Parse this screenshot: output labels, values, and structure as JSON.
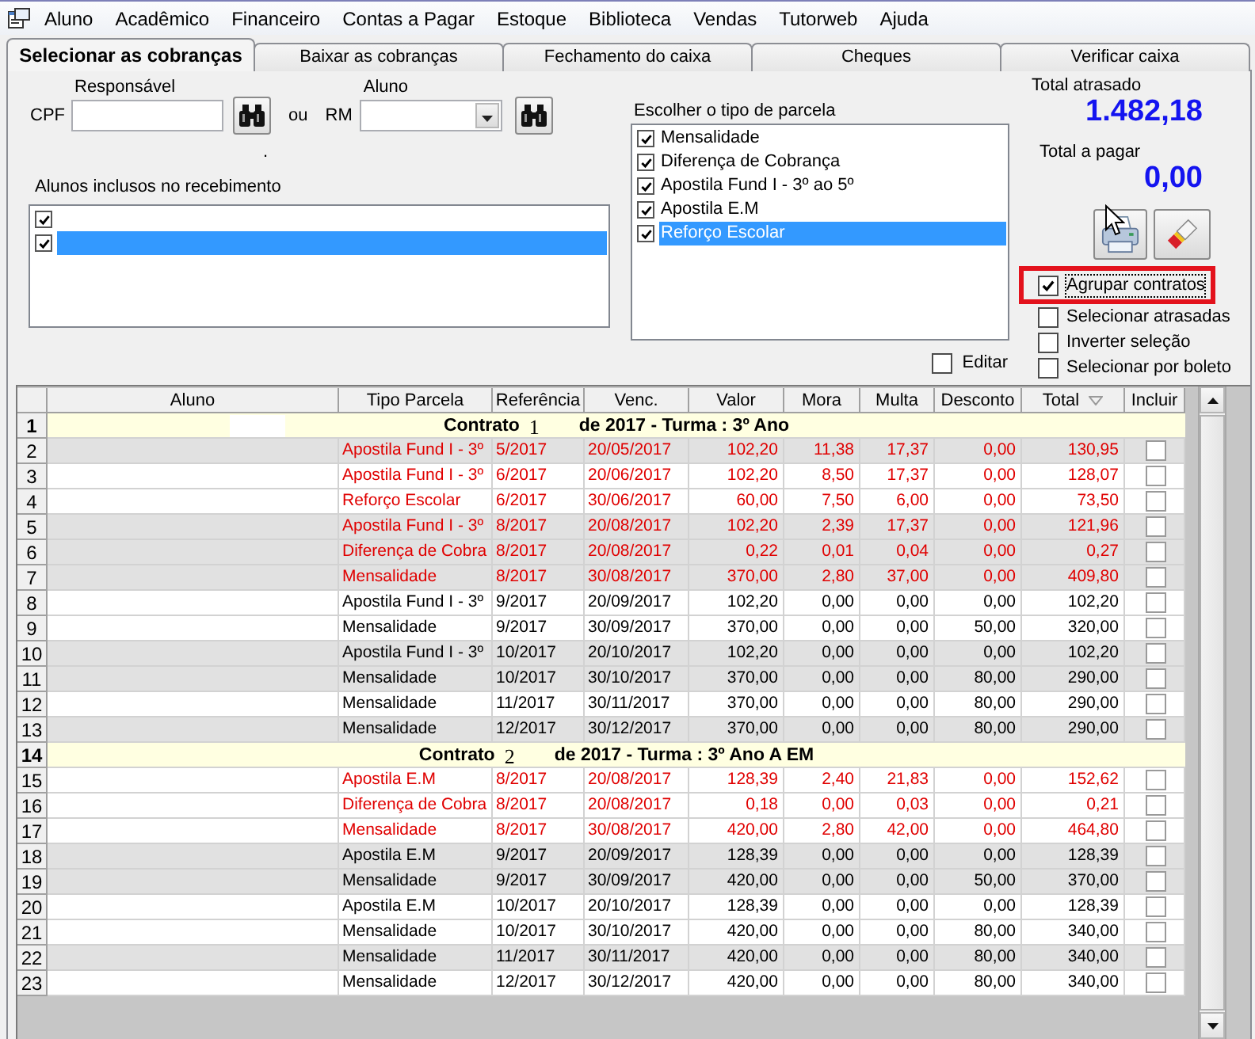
{
  "menu": [
    "Aluno",
    "Acadêmico",
    "Financeiro",
    "Contas a Pagar",
    "Estoque",
    "Biblioteca",
    "Vendas",
    "Tutorweb",
    "Ajuda"
  ],
  "tabs": [
    {
      "label": "Selecionar as cobranças",
      "selected": true
    },
    {
      "label": "Baixar as cobranças",
      "selected": false
    },
    {
      "label": "Fechamento do caixa",
      "selected": false
    },
    {
      "label": "Cheques",
      "selected": false
    },
    {
      "label": "Verificar caixa",
      "selected": false
    }
  ],
  "search": {
    "cpf_label": "CPF",
    "responsible_label": "Responsável",
    "or_label": "ou",
    "rm_label": "RM",
    "student_label": "Aluno"
  },
  "dot_label": ".",
  "included_students": {
    "label": "Alunos inclusos no recebimento",
    "items": [
      {
        "checked": true,
        "selected": false
      },
      {
        "checked": true,
        "selected": true
      }
    ]
  },
  "parcel_types": {
    "label": "Escolher o tipo de parcela",
    "items": [
      {
        "label": "Mensalidade",
        "checked": true,
        "selected": false
      },
      {
        "label": "Diferença de Cobrança",
        "checked": true,
        "selected": false
      },
      {
        "label": "Apostila Fund I - 3º ao 5º",
        "checked": true,
        "selected": false
      },
      {
        "label": "Apostila E.M",
        "checked": true,
        "selected": false
      },
      {
        "label": "Reforço Escolar",
        "checked": true,
        "selected": true
      }
    ]
  },
  "edit_option": {
    "label": "Editar",
    "checked": false
  },
  "totals": [
    {
      "label": "Total atrasado",
      "value": "1.482,18"
    },
    {
      "label": "Total a pagar",
      "value": "0,00"
    }
  ],
  "options": [
    {
      "label": "Agrupar contratos",
      "checked": true,
      "highlighted": true,
      "focused": true
    },
    {
      "label": "Selecionar atrasadas",
      "checked": false,
      "highlighted": false,
      "focused": false
    },
    {
      "label": "Inverter seleção",
      "checked": false,
      "highlighted": false,
      "focused": false
    },
    {
      "label": "Selecionar por boleto",
      "checked": false,
      "highlighted": false,
      "focused": false
    }
  ],
  "grid": {
    "columns": [
      {
        "label": "Aluno",
        "sorted": false
      },
      {
        "label": "Tipo Parcela",
        "sorted": false
      },
      {
        "label": "Referência",
        "sorted": false
      },
      {
        "label": "Venc.",
        "sorted": false
      },
      {
        "label": "Valor",
        "sorted": false
      },
      {
        "label": "Mora",
        "sorted": false
      },
      {
        "label": "Multa",
        "sorted": false
      },
      {
        "label": "Desconto",
        "sorted": false
      },
      {
        "label": "Total",
        "sorted": true
      },
      {
        "label": "Incluir",
        "sorted": false
      }
    ],
    "rows": [
      {
        "kind": "contract",
        "number": "1",
        "title": "Contrato",
        "contract_no": "1",
        "detail": "de 2017 - Turma : 3º Ano",
        "blank_patch": true
      },
      {
        "kind": "item",
        "number": "2",
        "cells": [
          "Apostila Fund I - 3º",
          "5/2017",
          "20/05/2017",
          "102,20",
          "11,38",
          "17,37",
          "0,00",
          "130,95"
        ],
        "overdue": true,
        "shaded": true,
        "included": false
      },
      {
        "kind": "item",
        "number": "3",
        "cells": [
          "Apostila Fund I - 3º",
          "6/2017",
          "20/06/2017",
          "102,20",
          "8,50",
          "17,37",
          "0,00",
          "128,07"
        ],
        "overdue": true,
        "shaded": false,
        "included": false
      },
      {
        "kind": "item",
        "number": "4",
        "cells": [
          "Reforço Escolar",
          "6/2017",
          "30/06/2017",
          "60,00",
          "7,50",
          "6,00",
          "0,00",
          "73,50"
        ],
        "overdue": true,
        "shaded": false,
        "included": false
      },
      {
        "kind": "item",
        "number": "5",
        "cells": [
          "Apostila Fund I - 3º",
          "8/2017",
          "20/08/2017",
          "102,20",
          "2,39",
          "17,37",
          "0,00",
          "121,96"
        ],
        "overdue": true,
        "shaded": true,
        "included": false
      },
      {
        "kind": "item",
        "number": "6",
        "cells": [
          "Diferença de Cobra",
          "8/2017",
          "20/08/2017",
          "0,22",
          "0,01",
          "0,04",
          "0,00",
          "0,27"
        ],
        "overdue": true,
        "shaded": true,
        "included": false
      },
      {
        "kind": "item",
        "number": "7",
        "cells": [
          "Mensalidade",
          "8/2017",
          "30/08/2017",
          "370,00",
          "2,80",
          "37,00",
          "0,00",
          "409,80"
        ],
        "overdue": true,
        "shaded": true,
        "included": false
      },
      {
        "kind": "item",
        "number": "8",
        "cells": [
          "Apostila Fund I - 3º",
          "9/2017",
          "20/09/2017",
          "102,20",
          "0,00",
          "0,00",
          "0,00",
          "102,20"
        ],
        "overdue": false,
        "shaded": false,
        "included": false
      },
      {
        "kind": "item",
        "number": "9",
        "cells": [
          "Mensalidade",
          "9/2017",
          "30/09/2017",
          "370,00",
          "0,00",
          "0,00",
          "50,00",
          "320,00"
        ],
        "overdue": false,
        "shaded": false,
        "included": false
      },
      {
        "kind": "item",
        "number": "10",
        "cells": [
          "Apostila Fund I - 3º",
          "10/2017",
          "20/10/2017",
          "102,20",
          "0,00",
          "0,00",
          "0,00",
          "102,20"
        ],
        "overdue": false,
        "shaded": true,
        "included": false
      },
      {
        "kind": "item",
        "number": "11",
        "cells": [
          "Mensalidade",
          "10/2017",
          "30/10/2017",
          "370,00",
          "0,00",
          "0,00",
          "80,00",
          "290,00"
        ],
        "overdue": false,
        "shaded": true,
        "included": false
      },
      {
        "kind": "item",
        "number": "12",
        "cells": [
          "Mensalidade",
          "11/2017",
          "30/11/2017",
          "370,00",
          "0,00",
          "0,00",
          "80,00",
          "290,00"
        ],
        "overdue": false,
        "shaded": false,
        "included": false
      },
      {
        "kind": "item",
        "number": "13",
        "cells": [
          "Mensalidade",
          "12/2017",
          "30/12/2017",
          "370,00",
          "0,00",
          "0,00",
          "80,00",
          "290,00"
        ],
        "overdue": false,
        "shaded": true,
        "included": false
      },
      {
        "kind": "contract",
        "number": "14",
        "title": "Contrato",
        "contract_no": "2",
        "detail": "de 2017 - Turma : 3º Ano A EM",
        "blank_patch": false
      },
      {
        "kind": "item",
        "number": "15",
        "cells": [
          "Apostila E.M",
          "8/2017",
          "20/08/2017",
          "128,39",
          "2,40",
          "21,83",
          "0,00",
          "152,62"
        ],
        "overdue": true,
        "shaded": false,
        "included": false
      },
      {
        "kind": "item",
        "number": "16",
        "cells": [
          "Diferença de Cobra",
          "8/2017",
          "20/08/2017",
          "0,18",
          "0,00",
          "0,03",
          "0,00",
          "0,21"
        ],
        "overdue": true,
        "shaded": false,
        "included": false
      },
      {
        "kind": "item",
        "number": "17",
        "cells": [
          "Mensalidade",
          "8/2017",
          "30/08/2017",
          "420,00",
          "2,80",
          "42,00",
          "0,00",
          "464,80"
        ],
        "overdue": true,
        "shaded": false,
        "included": false
      },
      {
        "kind": "item",
        "number": "18",
        "cells": [
          "Apostila E.M",
          "9/2017",
          "20/09/2017",
          "128,39",
          "0,00",
          "0,00",
          "0,00",
          "128,39"
        ],
        "overdue": false,
        "shaded": true,
        "included": false
      },
      {
        "kind": "item",
        "number": "19",
        "cells": [
          "Mensalidade",
          "9/2017",
          "30/09/2017",
          "420,00",
          "0,00",
          "0,00",
          "50,00",
          "370,00"
        ],
        "overdue": false,
        "shaded": true,
        "included": false
      },
      {
        "kind": "item",
        "number": "20",
        "cells": [
          "Apostila E.M",
          "10/2017",
          "20/10/2017",
          "128,39",
          "0,00",
          "0,00",
          "0,00",
          "128,39"
        ],
        "overdue": false,
        "shaded": false,
        "included": false
      },
      {
        "kind": "item",
        "number": "21",
        "cells": [
          "Mensalidade",
          "10/2017",
          "30/10/2017",
          "420,00",
          "0,00",
          "0,00",
          "80,00",
          "340,00"
        ],
        "overdue": false,
        "shaded": false,
        "included": false
      },
      {
        "kind": "item",
        "number": "22",
        "cells": [
          "Mensalidade",
          "11/2017",
          "30/11/2017",
          "420,00",
          "0,00",
          "0,00",
          "80,00",
          "340,00"
        ],
        "overdue": false,
        "shaded": true,
        "included": false
      },
      {
        "kind": "item",
        "number": "23",
        "cells": [
          "Mensalidade",
          "12/2017",
          "30/12/2017",
          "420,00",
          "0,00",
          "0,00",
          "80,00",
          "340,00"
        ],
        "overdue": false,
        "shaded": false,
        "included": false
      }
    ]
  }
}
